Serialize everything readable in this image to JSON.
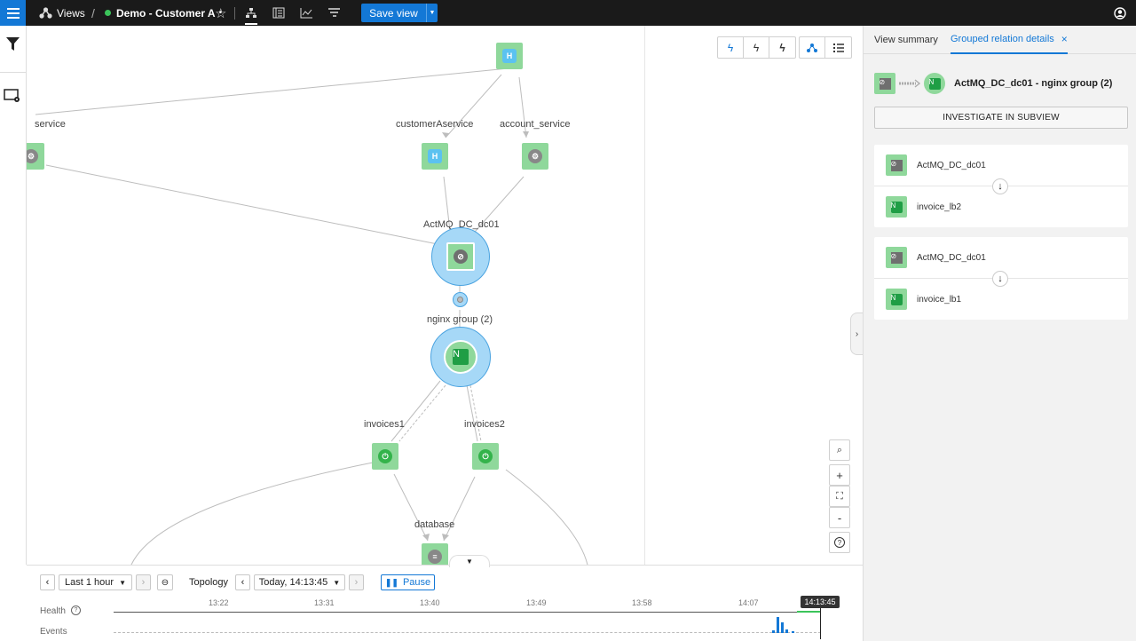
{
  "topbar": {
    "views_label": "Views",
    "separator": "/",
    "view_name": "Demo - Customer A",
    "unsaved_marker": "•",
    "save_label": "Save view"
  },
  "canvas": {
    "nodes": {
      "service_left": "service",
      "customer_a_service": "customerAservice",
      "account_service": "account_service",
      "actmq": "ActMQ_DC_dc01",
      "nginx_group": "nginx group (2)",
      "invoices1": "invoices1",
      "invoices2": "invoices2",
      "database": "database"
    },
    "zoom": {
      "plus": "+",
      "minus": "-",
      "help": "?"
    }
  },
  "rightpanel": {
    "tabs": [
      {
        "label": "View summary",
        "active": false
      },
      {
        "label": "Grouped relation details",
        "active": true
      }
    ],
    "close": "×",
    "header_title": "ActMQ_DC_dc01 - nginx group (2)",
    "investigate_label": "INVESTIGATE IN SUBVIEW",
    "relations": [
      {
        "source": "ActMQ_DC_dc01",
        "target": "invoice_lb2"
      },
      {
        "source": "ActMQ_DC_dc01",
        "target": "invoice_lb1"
      }
    ]
  },
  "timeline": {
    "range_label": "Last 1 hour",
    "mode_label": "Topology",
    "time_label": "Today, 14:13:45",
    "pause_label": "Pause",
    "health_label": "Health",
    "events_label": "Events",
    "ticks": [
      "13:22",
      "13:31",
      "13:40",
      "13:49",
      "13:58",
      "14:07"
    ],
    "current_time": "14:13:45"
  },
  "colors": {
    "accent": "#1378d6",
    "topbar": "#1a1a1a",
    "node_green": "#8fd89b",
    "selection_blue": "#a6d8f7",
    "status_dot": "#3bc45a"
  }
}
